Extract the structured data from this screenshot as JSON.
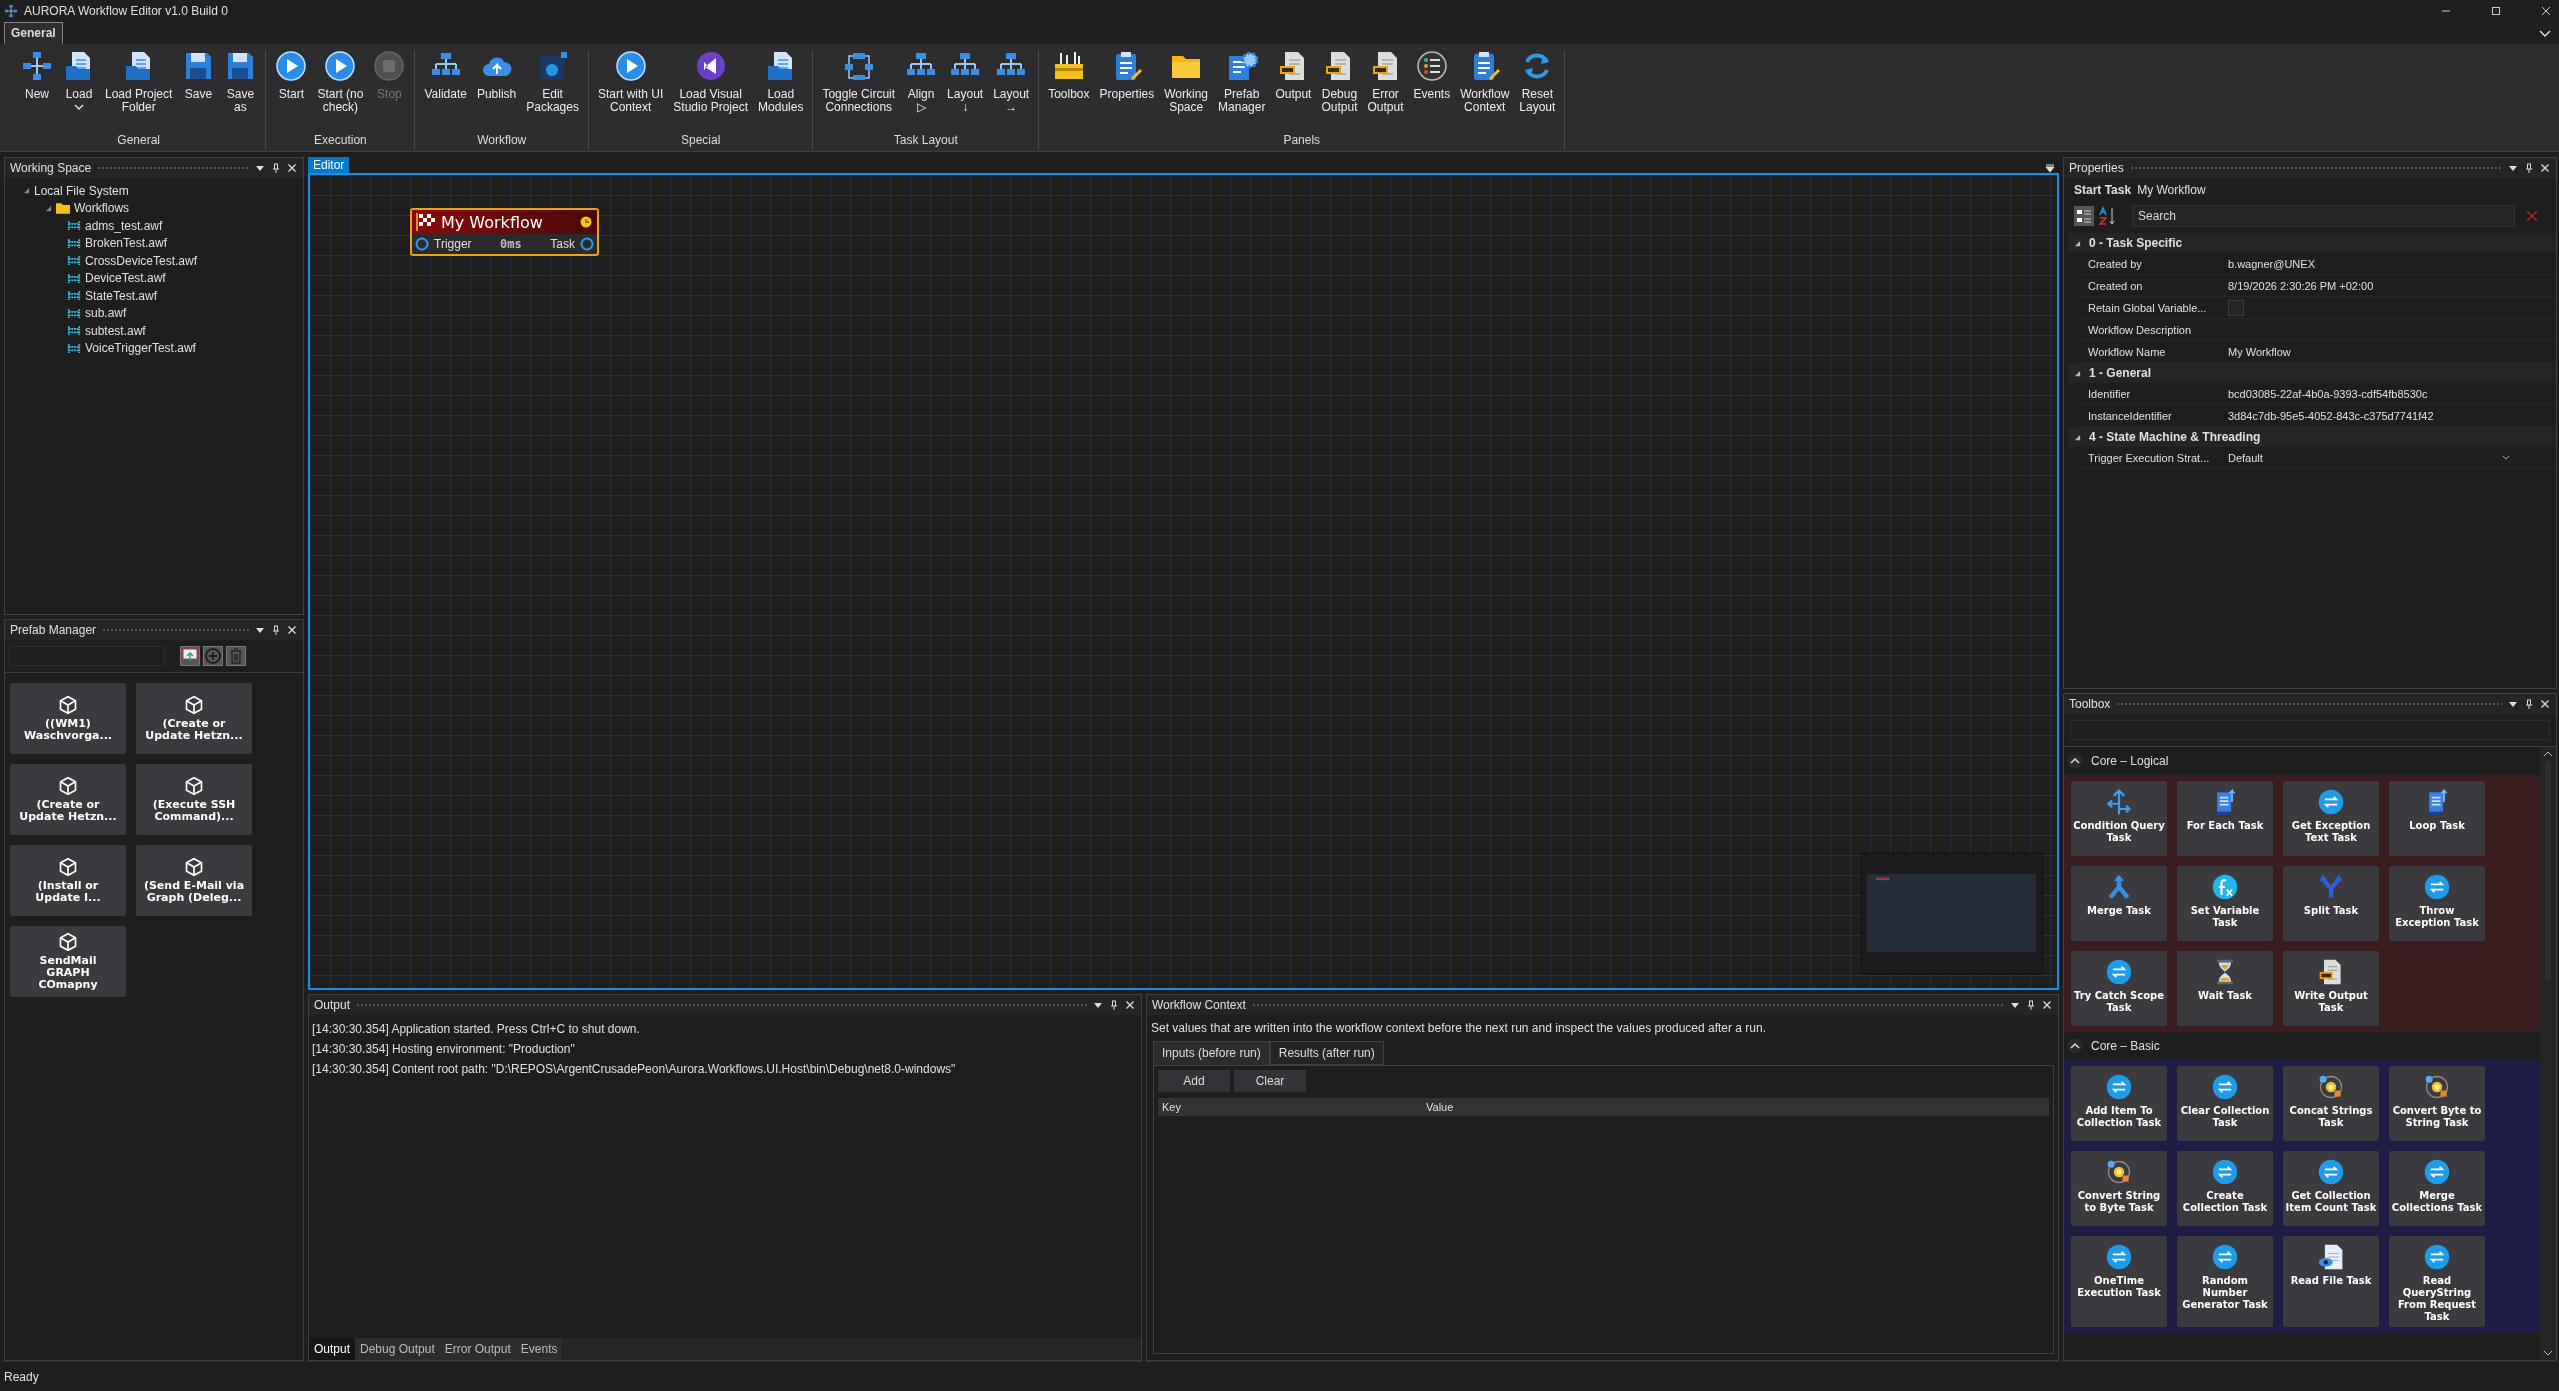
{
  "window": {
    "title": "AURORA Workflow Editor v1.0 Build 0"
  },
  "ribbon": {
    "tabs": [
      {
        "label": "General",
        "selected": true
      }
    ],
    "groups": [
      {
        "label": "General",
        "buttons": [
          {
            "lines": [
              "New"
            ],
            "kind": "flow",
            "disabled": false
          },
          {
            "lines": [
              "Load"
            ],
            "kind": "doc",
            "disabled": false,
            "dropdown": true
          },
          {
            "lines": [
              "Load Project",
              "Folder"
            ],
            "kind": "folderdoc",
            "disabled": false
          },
          {
            "lines": [
              "Save"
            ],
            "kind": "save",
            "disabled": false
          },
          {
            "lines": [
              "Save",
              "as"
            ],
            "kind": "save",
            "disabled": false
          }
        ]
      },
      {
        "label": "Execution",
        "buttons": [
          {
            "lines": [
              "Start"
            ],
            "kind": "play",
            "disabled": false
          },
          {
            "lines": [
              "Start (no",
              "check)"
            ],
            "kind": "play",
            "disabled": false
          },
          {
            "lines": [
              "Stop"
            ],
            "kind": "stop",
            "disabled": true
          }
        ]
      },
      {
        "label": "Workflow",
        "buttons": [
          {
            "lines": [
              "Validate"
            ],
            "kind": "tree",
            "disabled": false
          },
          {
            "lines": [
              "Publish"
            ],
            "kind": "cloud",
            "disabled": false
          },
          {
            "lines": [
              "Edit",
              "Packages"
            ],
            "kind": "package",
            "disabled": false
          }
        ]
      },
      {
        "label": "Special",
        "buttons": [
          {
            "lines": [
              "Start with UI",
              "Context"
            ],
            "kind": "play",
            "disabled": false
          },
          {
            "lines": [
              "Load Visual",
              "Studio Project"
            ],
            "kind": "vs",
            "disabled": false
          },
          {
            "lines": [
              "Load",
              "Modules"
            ],
            "kind": "folderdoc",
            "disabled": false
          }
        ]
      },
      {
        "label": "Task Layout",
        "buttons": [
          {
            "lines": [
              "Toggle Circuit",
              "Connections"
            ],
            "kind": "toggle",
            "disabled": false
          },
          {
            "lines": [
              "Align",
              "▷"
            ],
            "kind": "tree",
            "disabled": false
          },
          {
            "lines": [
              "Layout",
              "↓"
            ],
            "kind": "tree",
            "disabled": false
          },
          {
            "lines": [
              "Layout",
              "→"
            ],
            "kind": "tree",
            "disabled": false
          }
        ]
      },
      {
        "label": "Panels",
        "buttons": [
          {
            "lines": [
              "Toolbox"
            ],
            "kind": "toolbox",
            "disabled": false
          },
          {
            "lines": [
              "Properties"
            ],
            "kind": "clip",
            "disabled": false
          },
          {
            "lines": [
              "Working",
              "Space"
            ],
            "kind": "folder",
            "disabled": false
          },
          {
            "lines": [
              "Prefab",
              "Manager"
            ],
            "kind": "gear",
            "disabled": false
          },
          {
            "lines": [
              "Output"
            ],
            "kind": "log",
            "disabled": false
          },
          {
            "lines": [
              "Debug",
              "Output"
            ],
            "kind": "log",
            "disabled": false
          },
          {
            "lines": [
              "Error",
              "Output"
            ],
            "kind": "log",
            "disabled": false
          },
          {
            "lines": [
              "Events"
            ],
            "kind": "events",
            "disabled": false
          },
          {
            "lines": [
              "Workflow",
              "Context"
            ],
            "kind": "clip",
            "disabled": false
          },
          {
            "lines": [
              "Reset",
              "Layout"
            ],
            "kind": "reset",
            "disabled": false
          }
        ]
      }
    ]
  },
  "working_space": {
    "title": "Working Space",
    "tree": [
      {
        "label": "Local File System",
        "expanded": true,
        "children": [
          {
            "label": "Workflows",
            "kind": "folder",
            "expanded": true,
            "children": [
              {
                "label": "adms_test.awf",
                "kind": "file"
              },
              {
                "label": "BrokenTest.awf",
                "kind": "file"
              },
              {
                "label": "CrossDeviceTest.awf",
                "kind": "file"
              },
              {
                "label": "DeviceTest.awf",
                "kind": "file"
              },
              {
                "label": "StateTest.awf",
                "kind": "file"
              },
              {
                "label": "sub.awf",
                "kind": "file"
              },
              {
                "label": "subtest.awf",
                "kind": "file"
              },
              {
                "label": "VoiceTriggerTest.awf",
                "kind": "file"
              }
            ]
          }
        ]
      }
    ]
  },
  "prefab_manager": {
    "title": "Prefab Manager",
    "items": [
      "((WM1) Waschvorga...",
      "(Create or Update Hetzn...",
      "(Create or Update Hetzn...",
      "(Execute SSH Command)...",
      "(Install or Update I...",
      "(Send E-Mail via Graph (Deleg...",
      "SendMail GRAPH COmapny"
    ]
  },
  "editor": {
    "tab": "Editor",
    "node": {
      "title": "My Workflow",
      "input": "Trigger",
      "time": "0ms",
      "output": "Task"
    }
  },
  "output": {
    "title": "Output",
    "lines": [
      "[14:30:30.354] Application started. Press Ctrl+C to shut down.",
      "[14:30:30.354] Hosting environment: \"Production\"",
      "[14:30:30.354] Content root path: \"D:\\REPOS\\ArgentCrusadePeon\\Aurora.Workflows.UI.Host\\bin\\Debug\\net8.0-windows\""
    ],
    "tabs": [
      {
        "label": "Output",
        "selected": true
      },
      {
        "label": "Debug Output",
        "selected": false
      },
      {
        "label": "Error Output",
        "selected": false
      },
      {
        "label": "Events",
        "selected": false
      }
    ]
  },
  "workflow_context": {
    "title": "Workflow Context",
    "description": "Set values that are written into the workflow context before the next run and inspect the values produced after a run.",
    "tabs": [
      {
        "label": "Inputs (before run)",
        "selected": true
      },
      {
        "label": "Results (after run)",
        "selected": false
      }
    ],
    "buttons": [
      "Add",
      "Clear"
    ],
    "columns": [
      "Key",
      "Value"
    ]
  },
  "properties": {
    "title": "Properties",
    "type": "Start Task",
    "name": "My Workflow",
    "search": {
      "placeholder": "Search"
    },
    "categories": [
      {
        "label": "0 - Task Specific",
        "expanded": true,
        "rows": [
          {
            "kind": "text",
            "label": "Created by",
            "value": "b.wagner@UNEX"
          },
          {
            "kind": "text",
            "label": "Created on",
            "value": "8/19/2026 2:30:26 PM +02:00"
          },
          {
            "kind": "checkbox",
            "label": "Retain Global Variable...",
            "checked": false
          },
          {
            "kind": "text",
            "label": "Workflow Description"
          },
          {
            "kind": "text",
            "label": "Workflow Name",
            "value": "My Workflow"
          }
        ]
      },
      {
        "label": "1 - General",
        "expanded": true,
        "rows": [
          {
            "kind": "text",
            "label": "Identifier",
            "value": "bcd03085-22af-4b0a-9393-cdf54fb8530c"
          },
          {
            "kind": "text",
            "label": "InstanceIdentifier",
            "value": "3d84c7db-95e5-4052-843c-c375d7741f42"
          }
        ]
      },
      {
        "label": "4 - State Machine & Threading",
        "expanded": true,
        "rows": [
          {
            "kind": "dropdown",
            "label": "Trigger Execution Strat...",
            "value": "Default"
          }
        ]
      }
    ]
  },
  "toolbox": {
    "title": "Toolbox",
    "groups": [
      {
        "label": "Core – Logical",
        "expanded": true,
        "color": "#3c1d1f",
        "items": [
          {
            "label": "Condition Query Task",
            "kind": "condition"
          },
          {
            "label": "For Each Task",
            "kind": "list"
          },
          {
            "label": "Get Exception Text Task",
            "kind": "arrows"
          },
          {
            "label": "Loop Task",
            "kind": "list"
          },
          {
            "label": "Merge Task",
            "kind": "merge"
          },
          {
            "label": "Set Variable Task",
            "kind": "fx"
          },
          {
            "label": "Split Task",
            "kind": "split"
          },
          {
            "label": "Throw Exception Task",
            "kind": "arrows"
          },
          {
            "label": "Try Catch Scope Task",
            "kind": "arrows"
          },
          {
            "label": "Wait Task",
            "kind": "hourglass"
          },
          {
            "label": "Write Output Task",
            "kind": "log"
          }
        ]
      },
      {
        "label": "Core – Basic",
        "expanded": true,
        "color": "#1d1d45",
        "items": [
          {
            "label": "Add Item To Collection Task",
            "kind": "arrows"
          },
          {
            "label": "Clear Collection Task",
            "kind": "arrows"
          },
          {
            "label": "Concat Strings Task",
            "kind": "gears"
          },
          {
            "label": "Convert Byte to String Task",
            "kind": "gears"
          },
          {
            "label": "Convert String to Byte Task",
            "kind": "gears"
          },
          {
            "label": "Create Collection Task",
            "kind": "arrows"
          },
          {
            "label": "Get Collection Item Count Task",
            "kind": "arrows"
          },
          {
            "label": "Merge Collections Task",
            "kind": "arrows"
          },
          {
            "label": "OneTime Execution Task",
            "kind": "arrows"
          },
          {
            "label": "Random Number Generator Task",
            "kind": "arrows"
          },
          {
            "label": "Read File Task",
            "kind": "readfile"
          },
          {
            "label": "Read QueryString From Request Task",
            "kind": "arrows"
          }
        ]
      }
    ]
  },
  "status_bar": {
    "text": "Ready"
  }
}
